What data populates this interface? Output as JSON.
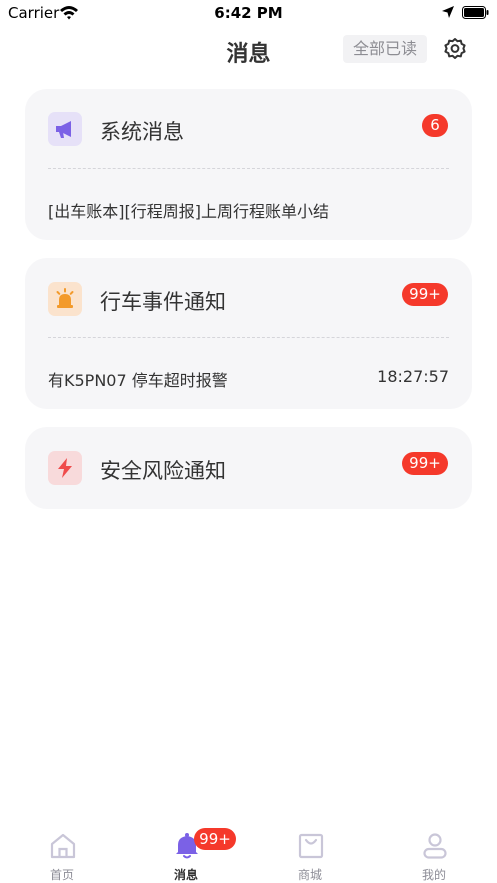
{
  "status_bar": {
    "carrier": "Carrier",
    "time": "6:42 PM"
  },
  "header": {
    "title": "消息",
    "mark_all_read": "全部已读"
  },
  "cards": [
    {
      "title": "系统消息",
      "badge": "6",
      "message": "[出车账本][行程周报]上周行程账单小结",
      "icon": "megaphone-icon",
      "icon_color": "#7b61e6",
      "icon_bg": "#e6e1f8"
    },
    {
      "title": "行车事件通知",
      "badge": "99+",
      "message": "有K5PN07 停车超时报警",
      "time": "18:27:57",
      "icon": "alarm-light-icon",
      "icon_color": "#f39a2b",
      "icon_bg": "#fbe3cd"
    },
    {
      "title": "安全风险通知",
      "badge": "99+",
      "icon": "lightning-icon",
      "icon_color": "#ef4b4b",
      "icon_bg": "#f8dadb"
    }
  ],
  "tab_bar": {
    "items": [
      {
        "label": "首页",
        "icon": "home-icon"
      },
      {
        "label": "消息",
        "icon": "bell-icon",
        "badge": "99+",
        "active": true
      },
      {
        "label": "商城",
        "icon": "shopping-bag-icon"
      },
      {
        "label": "我的",
        "icon": "user-icon"
      }
    ]
  },
  "colors": {
    "badge": "#f5392b",
    "active_tab": "#7b61e6",
    "inactive_tab": "#c9c6d8"
  }
}
